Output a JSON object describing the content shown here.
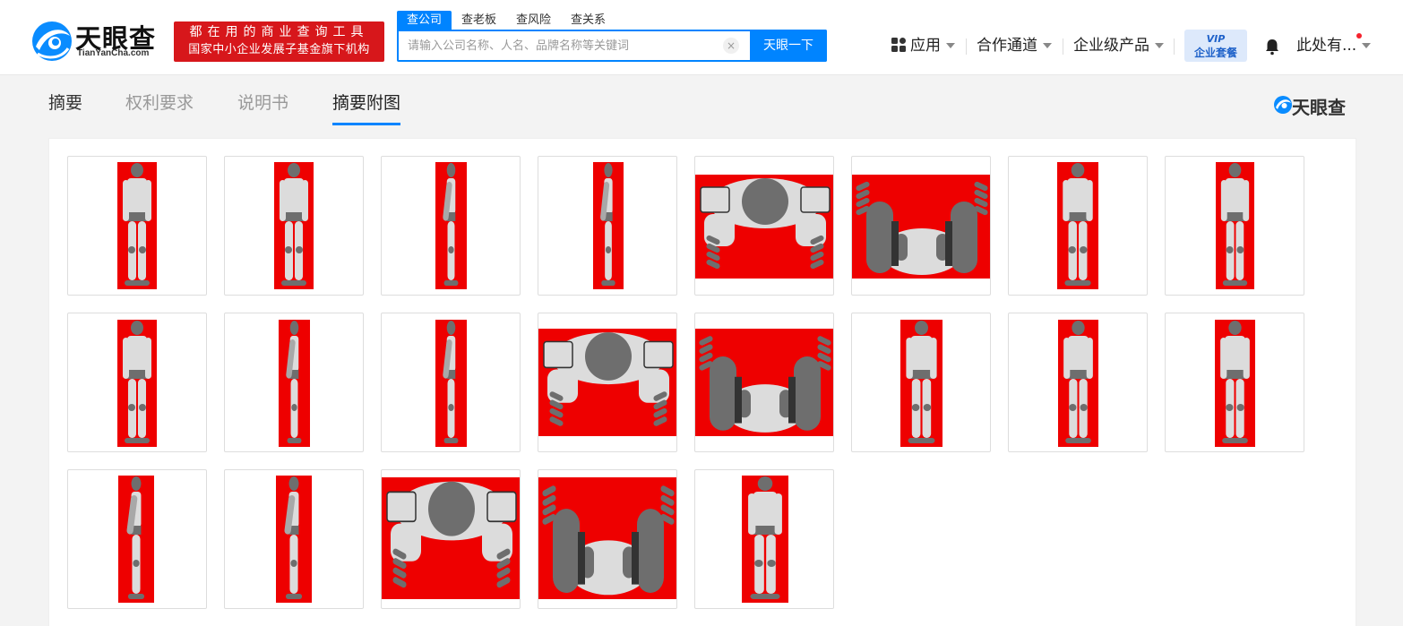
{
  "header": {
    "logo_cn": "天眼查",
    "logo_en": "TianYanCha.com",
    "slogan_line1": "都在用的商业查询工具",
    "slogan_line2": "国家中小企业发展子基金旗下机构",
    "search_tabs": [
      "查公司",
      "查老板",
      "查风险",
      "查关系"
    ],
    "search_placeholder": "请输入公司名称、人名、品牌名称等关键词",
    "search_clear": "×",
    "search_button": "天眼一下",
    "nav": {
      "apps": "应用",
      "partner": "合作通道",
      "enterprise": "企业级产品",
      "vip_top": "VIP",
      "vip_bottom": "企业套餐",
      "user": "此处有..."
    }
  },
  "tabs": [
    "摘要",
    "权利要求",
    "说明书",
    "摘要附图"
  ],
  "active_tab": "摘要附图",
  "brand_right": "天眼查",
  "colors": {
    "accent": "#0084ff",
    "slogan_red": "#d7171b",
    "figure_red": "#ee0000"
  },
  "icons": [
    "apps-icon",
    "bell-icon",
    "logo-eye-icon",
    "search-clear-icon"
  ],
  "figures": [
    {
      "label": "robot front view"
    },
    {
      "label": "robot front view"
    },
    {
      "label": "robot side view"
    },
    {
      "label": "robot side view"
    },
    {
      "label": "robot top view"
    },
    {
      "label": "robot bottom view"
    },
    {
      "label": "robot rear view"
    },
    {
      "label": "robot front view"
    },
    {
      "label": "robot rear view"
    },
    {
      "label": "robot side view"
    },
    {
      "label": "robot side view"
    },
    {
      "label": "robot top view"
    },
    {
      "label": "robot bottom view"
    },
    {
      "label": "robot perspective view"
    },
    {
      "label": "robot front view"
    },
    {
      "label": "robot rear view"
    },
    {
      "label": "robot side view"
    },
    {
      "label": "robot side view"
    },
    {
      "label": "robot top view"
    },
    {
      "label": "robot bottom view"
    },
    {
      "label": "robot perspective view"
    }
  ]
}
